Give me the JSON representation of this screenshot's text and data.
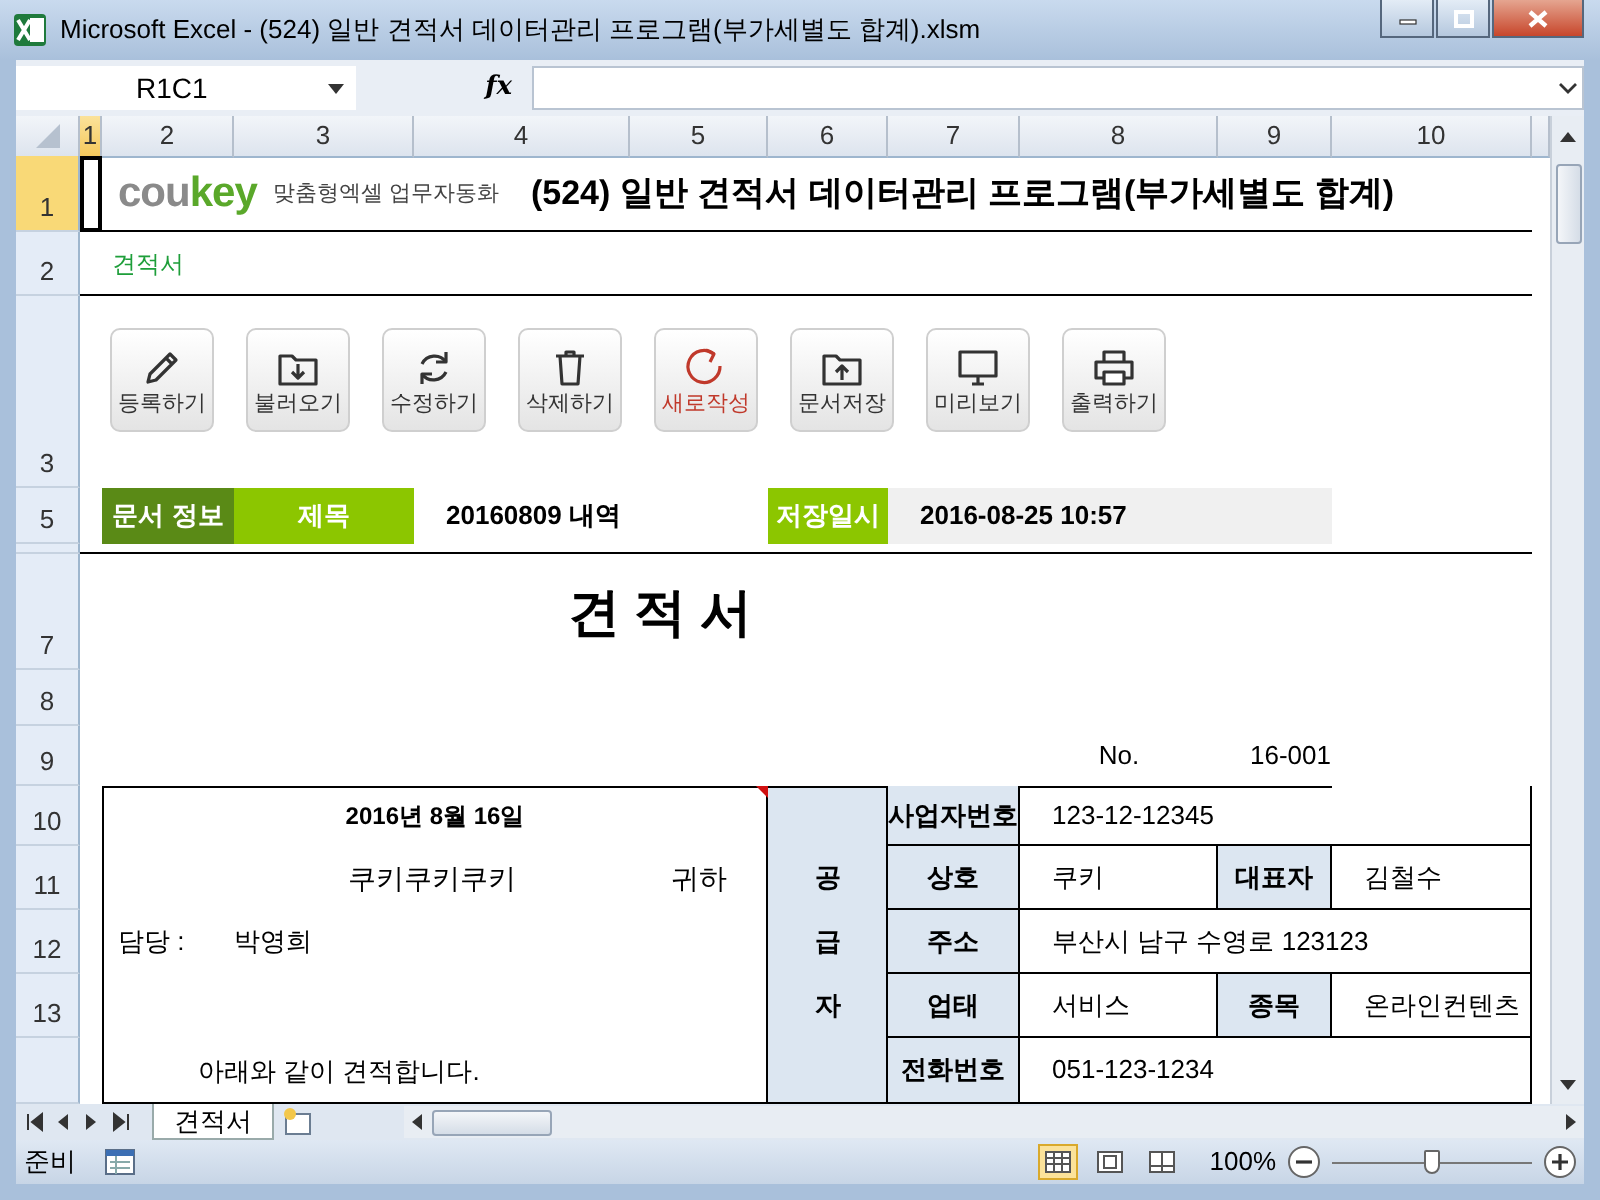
{
  "window": {
    "title": "Microsoft Excel - (524) 일반 견적서 데이터관리 프로그램(부가세별도 합계).xlsm"
  },
  "formula_bar": {
    "name_box": "R1C1",
    "function_label": "fx"
  },
  "column_headers": [
    {
      "label": "1",
      "selected": true
    },
    {
      "label": "2",
      "selected": false
    },
    {
      "label": "3",
      "selected": false
    },
    {
      "label": "4",
      "selected": false
    },
    {
      "label": "5",
      "selected": false
    },
    {
      "label": "6",
      "selected": false
    },
    {
      "label": "7",
      "selected": false
    },
    {
      "label": "8",
      "selected": false
    },
    {
      "label": "9",
      "selected": false
    },
    {
      "label": "10",
      "selected": false
    }
  ],
  "row_headers": [
    {
      "label": "1",
      "selected": true
    },
    {
      "label": "2",
      "selected": false
    },
    {
      "label": "3",
      "selected": false
    },
    {
      "label": "5",
      "selected": false
    },
    {
      "label": "7",
      "selected": false
    },
    {
      "label": "8",
      "selected": false
    },
    {
      "label": "9",
      "selected": false
    },
    {
      "label": "10",
      "selected": false
    },
    {
      "label": "11",
      "selected": false
    },
    {
      "label": "12",
      "selected": false
    },
    {
      "label": "13",
      "selected": false
    }
  ],
  "sheet": {
    "logo_parts": [
      "cou",
      "key"
    ],
    "tagline": "맞춤형엑셀 업무자동화",
    "title": "(524) 일반 견적서 데이터관리 프로그램(부가세별도 합계)",
    "section_link": "견적서"
  },
  "toolbar": [
    {
      "label": "등록하기",
      "kind": "pencil",
      "accent": false
    },
    {
      "label": "불러오기",
      "kind": "folder_down",
      "accent": false
    },
    {
      "label": "수정하기",
      "kind": "refresh",
      "accent": false
    },
    {
      "label": "삭제하기",
      "kind": "trash",
      "accent": false
    },
    {
      "label": "새로작성",
      "kind": "restart",
      "accent": true
    },
    {
      "label": "문서저장",
      "kind": "folder_up",
      "accent": false
    },
    {
      "label": "미리보기",
      "kind": "monitor",
      "accent": false
    },
    {
      "label": "출력하기",
      "kind": "printer",
      "accent": false
    }
  ],
  "doc_info": {
    "section_label": "문서 정보",
    "title_label": "제목",
    "title_value": "20160809 내역",
    "saved_label": "저장일시",
    "saved_value": "2016-08-25 10:57"
  },
  "document": {
    "heading": "견 적 서",
    "number_label": "No.",
    "number": "16-001",
    "date": "2016년 8월 16일",
    "recipient": "쿠키쿠키쿠키",
    "honorific": "귀하",
    "contact_label": "담당 :",
    "contact": "박영희",
    "note": "아래와 같이 견적합니다.",
    "supplier_label": [
      "공",
      "급",
      "자"
    ],
    "supplier_rows": [
      {
        "cells": [
          {
            "label": "사업자번호",
            "value": "123-12-12345"
          }
        ]
      },
      {
        "cells": [
          {
            "label": "상호",
            "value": "쿠키"
          },
          {
            "label": "대표자",
            "value": "김철수"
          }
        ]
      },
      {
        "cells": [
          {
            "label": "주소",
            "value": "부산시 남구 수영로 123123"
          }
        ]
      },
      {
        "cells": [
          {
            "label": "업태",
            "value": "서비스"
          },
          {
            "label": "종목",
            "value": "온라인컨텐츠"
          }
        ]
      },
      {
        "cells": [
          {
            "label": "전화번호",
            "value": "051-123-1234"
          }
        ]
      }
    ]
  },
  "sheet_tabs": [
    {
      "label": "견적서",
      "selected": true
    }
  ],
  "status_bar": {
    "status": "준비",
    "zoom": "100%",
    "level": 0.5,
    "views": [
      {
        "kind": "normal",
        "selected": true
      },
      {
        "kind": "page_layout",
        "selected": false
      },
      {
        "kind": "page_break",
        "selected": false
      }
    ]
  }
}
